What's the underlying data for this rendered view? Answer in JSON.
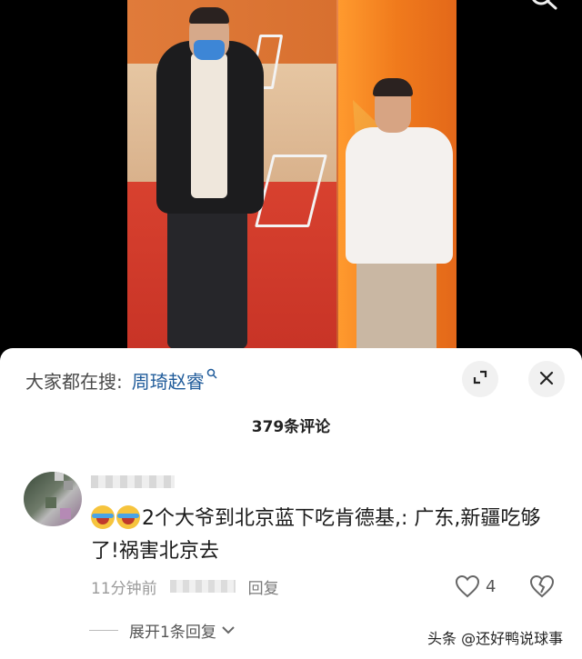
{
  "video": {
    "search_icon": "search-icon"
  },
  "sheet": {
    "suggest_prefix": "大家都在搜:",
    "suggest_term": "周琦赵睿",
    "suggest_icon": "search-small-icon",
    "expand_icon": "expand-icon",
    "close_icon": "close-icon",
    "comment_count": "379条评论"
  },
  "comment": {
    "text": "2个大爷到北京蓝下吃肯德基,: 广东,新疆吃够了!祸害北京去",
    "time": "11分钟前",
    "reply_label": "回复",
    "like_count": "4",
    "expand_replies": "展开1条回复"
  },
  "watermark": "头条 @还好鸭说球事",
  "colors": {
    "link": "#1f5b9a",
    "meta": "#9a9a9a",
    "sheet_bg": "#ffffff"
  }
}
